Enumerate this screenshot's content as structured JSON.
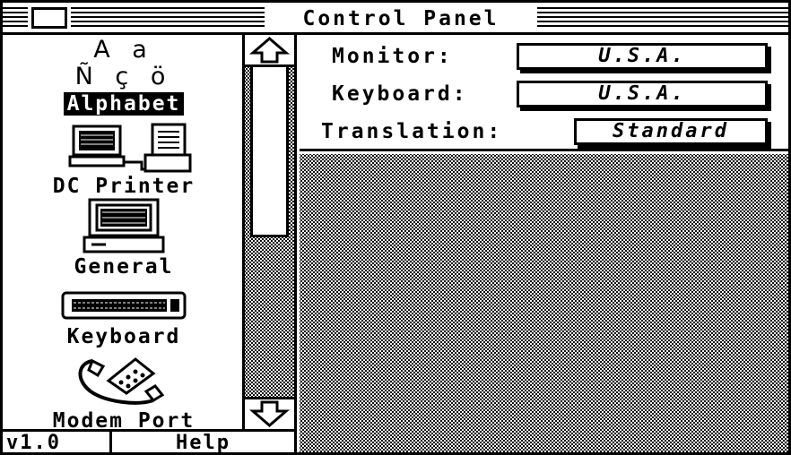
{
  "window": {
    "title": "Control Panel"
  },
  "sidebar": {
    "items": [
      {
        "label": "Alphabet",
        "icon": "alphabet-icon",
        "glyphs_top": "A a",
        "glyphs_bottom": "Ñ ç ö",
        "selected": true
      },
      {
        "label": "DC Printer",
        "icon": "printer-icon",
        "selected": false
      },
      {
        "label": "General",
        "icon": "computer-icon",
        "selected": false
      },
      {
        "label": "Keyboard",
        "icon": "keyboard-icon",
        "selected": false
      },
      {
        "label": "Modem Port",
        "icon": "telephone-icon",
        "selected": false
      }
    ]
  },
  "scrollbar": {
    "up_icon": "up-arrow-icon",
    "down_icon": "down-arrow-icon",
    "position": 0
  },
  "footer": {
    "version": "v1.0",
    "help_label": "Help"
  },
  "settings": {
    "monitor": {
      "label": "Monitor:",
      "value": "U.S.A."
    },
    "keyboard": {
      "label": "Keyboard:",
      "value": "U.S.A."
    },
    "translation": {
      "label": "Translation:",
      "value": "Standard"
    }
  }
}
